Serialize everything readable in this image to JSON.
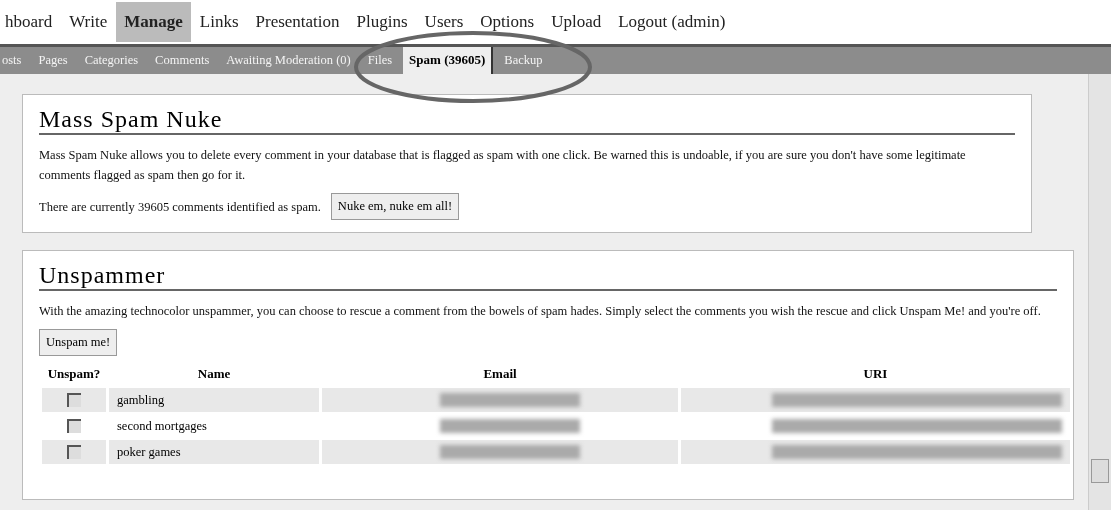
{
  "nav": [
    {
      "label": "hboard",
      "selected": false
    },
    {
      "label": "Write",
      "selected": false
    },
    {
      "label": "Manage",
      "selected": true
    },
    {
      "label": "Links",
      "selected": false
    },
    {
      "label": "Presentation",
      "selected": false
    },
    {
      "label": "Plugins",
      "selected": false
    },
    {
      "label": "Users",
      "selected": false
    },
    {
      "label": "Options",
      "selected": false
    },
    {
      "label": "Upload",
      "selected": false
    },
    {
      "label": "Logout (admin)",
      "selected": false
    }
  ],
  "subnav": [
    {
      "label": "osts",
      "selected": false
    },
    {
      "label": "Pages",
      "selected": false
    },
    {
      "label": "Categories",
      "selected": false
    },
    {
      "label": "Comments",
      "selected": false
    },
    {
      "label": "Awaiting Moderation (0)",
      "selected": false
    },
    {
      "label": "Files",
      "selected": false
    },
    {
      "label": "Spam (39605)",
      "selected": true
    },
    {
      "label": "Backup",
      "selected": false
    }
  ],
  "nuke": {
    "title": "Mass Spam Nuke",
    "description": "Mass Spam Nuke allows you to delete every comment in your database that is flagged as spam with one click. Be warned this is undoable, if you are sure you don't have some legitimate comments flagged as spam then go for it.",
    "count_text": "There are currently 39605 comments identified as spam.",
    "button": "Nuke em, nuke em all!"
  },
  "unspammer": {
    "title": "Unspammer",
    "description": "With the amazing technocolor unspammer, you can choose to rescue a comment from the bowels of spam hades. Simply select the comments you wish the rescue and click Unspam Me! and you're off.",
    "button": "Unspam me!",
    "columns": [
      "Unspam?",
      "Name",
      "Email",
      "URI"
    ],
    "rows": [
      {
        "checked": false,
        "name": "gambling"
      },
      {
        "checked": false,
        "name": "second mortgages"
      },
      {
        "checked": false,
        "name": "poker games"
      }
    ]
  }
}
